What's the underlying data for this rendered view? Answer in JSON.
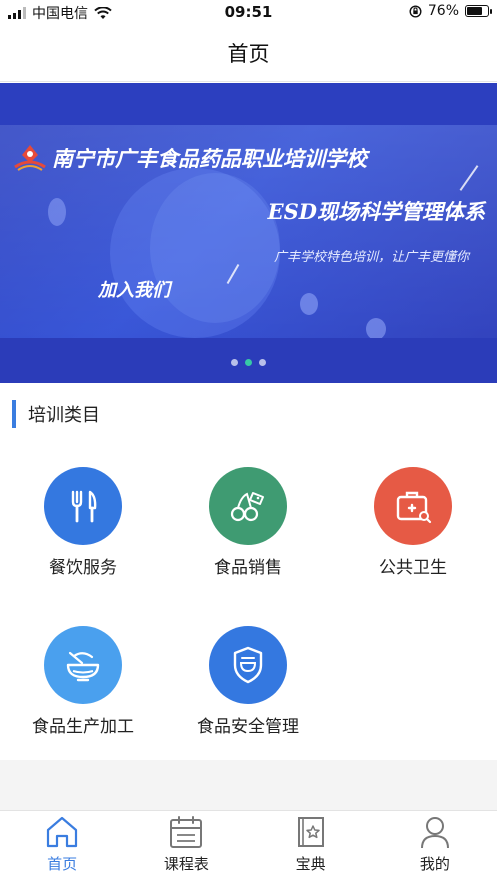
{
  "status_bar": {
    "carrier": "中国电信",
    "time": "09:51",
    "battery": "76%",
    "battery_level": 0.76
  },
  "nav": {
    "title": "首页"
  },
  "banner": {
    "school_name": "南宁市广丰食品药品职业培训学校",
    "headline": "ESD现场科学管理体系",
    "slogan": "广丰学校特色培训，让广丰更懂你",
    "cta": "加入我们",
    "slide_count": 3,
    "active_slide": 1
  },
  "section": {
    "title": "培训类目"
  },
  "categories": [
    {
      "label": "餐饮服务",
      "icon": "fork-knife-icon",
      "color": "#3478e0"
    },
    {
      "label": "食品销售",
      "icon": "cherries-tag-icon",
      "color": "#3f9b72"
    },
    {
      "label": "公共卫生",
      "icon": "medical-kit-icon",
      "color": "#e65a45"
    },
    {
      "label": "食品生产加工",
      "icon": "bowl-icon",
      "color": "#4aa0ee"
    },
    {
      "label": "食品安全管理",
      "icon": "shield-bowl-icon",
      "color": "#3478e0"
    }
  ],
  "tabs": [
    {
      "label": "首页",
      "icon": "home-icon",
      "active": true
    },
    {
      "label": "课程表",
      "icon": "calendar-icon",
      "active": false
    },
    {
      "label": "宝典",
      "icon": "book-star-icon",
      "active": false
    },
    {
      "label": "我的",
      "icon": "user-icon",
      "active": false
    }
  ],
  "colors": {
    "accent": "#3a7de0",
    "banner_bg": "#2f46c8",
    "carousel_active_dot": "#37c9a6"
  }
}
